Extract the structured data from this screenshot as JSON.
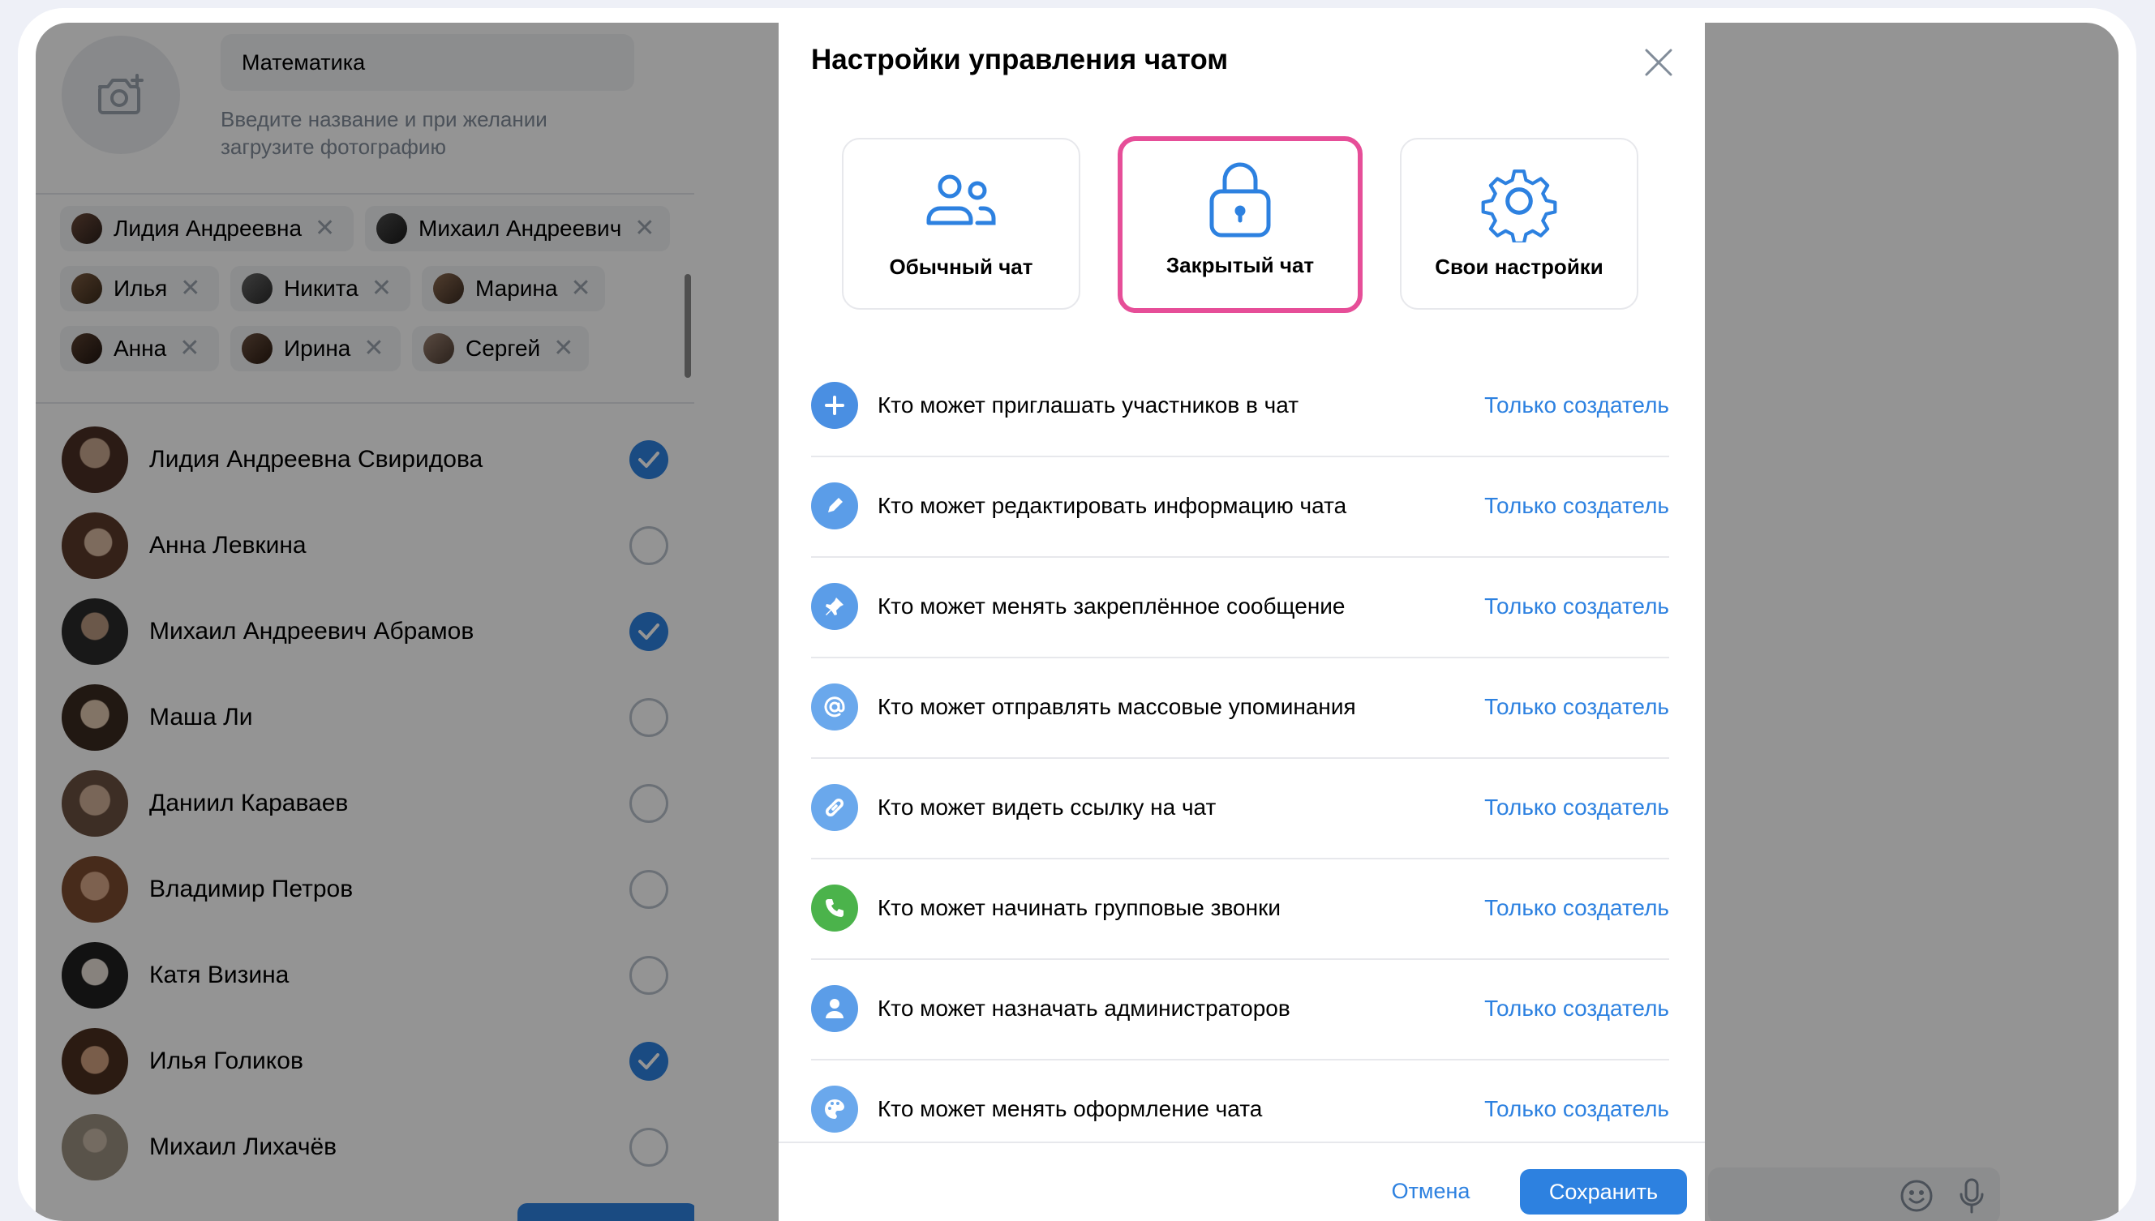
{
  "chat_form": {
    "title_value": "Математика",
    "hint": "Введите название и при желании загрузите фотографию",
    "camera_icon": "camera-plus-icon"
  },
  "selected_chips": [
    {
      "label": "Лидия Андреевна"
    },
    {
      "label": "Михаил Андреевич"
    },
    {
      "label": "Илья"
    },
    {
      "label": "Никита"
    },
    {
      "label": "Марина"
    },
    {
      "label": "Анна"
    },
    {
      "label": "Ирина"
    },
    {
      "label": "Сергей"
    }
  ],
  "contacts": [
    {
      "name": "Лидия Андреевна Свиридова",
      "checked": true
    },
    {
      "name": "Анна Левкина",
      "checked": false
    },
    {
      "name": "Михаил Андреевич Абрамов",
      "checked": true
    },
    {
      "name": "Маша Ли",
      "checked": false
    },
    {
      "name": "Даниил Караваев",
      "checked": false
    },
    {
      "name": "Владимир Петров",
      "checked": false
    },
    {
      "name": "Катя Визина",
      "checked": false
    },
    {
      "name": "Илья Голиков",
      "checked": true
    },
    {
      "name": "Михаил Лихачёв",
      "checked": false
    }
  ],
  "modal": {
    "title": "Настройки управления чатом",
    "modes": [
      {
        "label": "Обычный чат",
        "icon": "users-icon",
        "selected": false
      },
      {
        "label": "Закрытый чат",
        "icon": "lock-icon",
        "selected": true
      },
      {
        "label": "Свои настройки",
        "icon": "gear-icon",
        "selected": false
      }
    ],
    "settings": [
      {
        "label": "Кто может приглашать участников в чат",
        "value": "Только создатель",
        "icon": "plus-icon",
        "color": "#4a8fe2"
      },
      {
        "label": "Кто может редактировать информацию чата",
        "value": "Только создатель",
        "icon": "pencil-icon",
        "color": "#5b9de8"
      },
      {
        "label": "Кто может менять закреплённое сообщение",
        "value": "Только создатель",
        "icon": "pin-icon",
        "color": "#5b9de8"
      },
      {
        "label": "Кто может отправлять массовые упоминания",
        "value": "Только создатель",
        "icon": "at-icon",
        "color": "#6aa8ec"
      },
      {
        "label": "Кто может видеть ссылку на чат",
        "value": "Только создатель",
        "icon": "link-icon",
        "color": "#6aa8ec"
      },
      {
        "label": "Кто может начинать групповые звонки",
        "value": "Только создатель",
        "icon": "phone-icon",
        "color": "#4bb34b"
      },
      {
        "label": "Кто может назначать администраторов",
        "value": "Только создатель",
        "icon": "user-icon",
        "color": "#5b9de8"
      },
      {
        "label": "Кто может менять оформление чата",
        "value": "Только создатель",
        "icon": "palette-icon",
        "color": "#6aa8ec"
      }
    ],
    "cancel_label": "Отмена",
    "save_label": "Сохранить"
  },
  "colors": {
    "accent": "#2d81e0",
    "selected_border": "#e64e98",
    "green": "#4bb34b",
    "overlay": "rgba(0,0,0,0.42)"
  }
}
